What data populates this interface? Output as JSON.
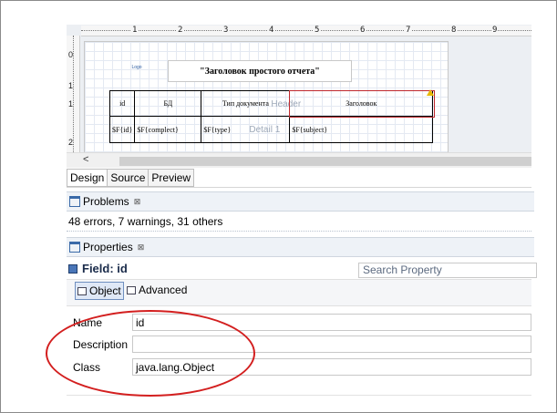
{
  "ruler": {
    "marks": [
      "1",
      "2",
      "3",
      "4",
      "5",
      "6",
      "7",
      "8",
      "9"
    ]
  },
  "vruler": {
    "marks": [
      "0",
      "1",
      "1",
      "2"
    ]
  },
  "report": {
    "logo_text": "Logo",
    "title": "\"Заголовок простого отчета\"",
    "headers": [
      "id",
      "БД",
      "Тип документа",
      "Заголовок"
    ],
    "fields": [
      "$F{id}",
      "$F{complect}",
      "$F{type}",
      "$F{subject}"
    ],
    "band_header": "Header",
    "band_detail": "Detail 1"
  },
  "editor_tabs": [
    "Design",
    "Source",
    "Preview"
  ],
  "problems": {
    "title": "Problems",
    "close": "⊠",
    "summary": "48 errors, 7 warnings, 31 others"
  },
  "properties": {
    "title": "Properties",
    "close": "⊠",
    "field_title": "Field: id",
    "search_placeholder": "Search Property",
    "subtabs": [
      "Object",
      "Advanced"
    ],
    "rows": [
      {
        "label": "Name",
        "value": "id"
      },
      {
        "label": "Description",
        "value": ""
      },
      {
        "label": "Class",
        "value": "java.lang.Object"
      }
    ]
  },
  "colors": {
    "annotation": "#d31f1f",
    "accent": "#4a76b8"
  }
}
